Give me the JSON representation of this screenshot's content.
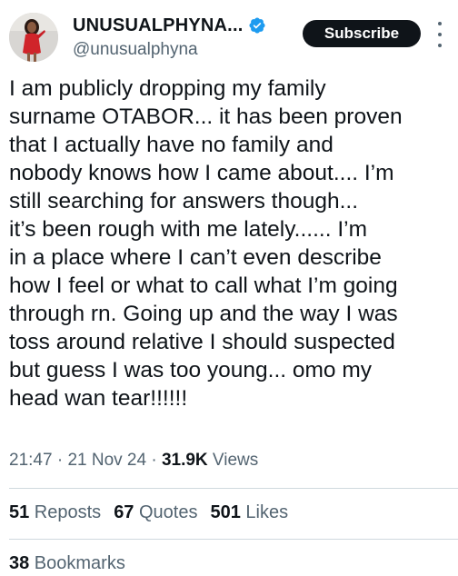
{
  "author": {
    "display_name": "UNUSUALPHYNA...",
    "handle": "@unusualphyna",
    "verified": true,
    "avatar": "profile-photo"
  },
  "header": {
    "subscribe_label": "Subscribe",
    "more_icon": "more-vertical-icon"
  },
  "tweet": {
    "lines": [
      "I am publicly dropping my family",
      "surname OTABOR... it has been proven",
      "that I actually have no family and",
      "nobody knows how I came about.... I’m",
      "still searching for answers though...",
      "it’s been rough with me lately...... I’m",
      "in a place where I can’t even describe",
      "how I feel or what to call what I’m going",
      "through rn. Going up and the way I was",
      "toss around relative I should suspected",
      "but guess I was too young... omo my",
      "head wan tear!!!!!!"
    ]
  },
  "meta": {
    "time": "21:47",
    "separator": " · ",
    "date": "21 Nov 24",
    "views_count": "31.9K",
    "views_label": " Views"
  },
  "stats": {
    "reposts_count": "51",
    "reposts_label": " Reposts",
    "quotes_count": "67",
    "quotes_label": " Quotes",
    "likes_count": "501",
    "likes_label": " Likes",
    "bookmarks_count": "38",
    "bookmarks_label": " Bookmarks"
  },
  "colors": {
    "primary_text": "#0f1419",
    "secondary_text": "#536471",
    "verified_blue": "#1d9bf0",
    "divider": "#cfd9de"
  }
}
